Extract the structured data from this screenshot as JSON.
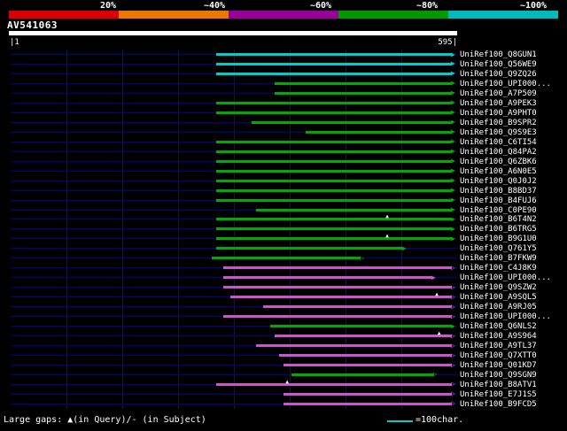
{
  "chart_data": {
    "type": "bar",
    "orientation": "horizontal-span",
    "title": "AV541063",
    "query_length": 595,
    "x_axis": {
      "start_label": "|1",
      "end_label": "595|"
    },
    "grid": true,
    "identity_scale": {
      "labels": [
        "20%",
        "~40%",
        "~60%",
        "~80%",
        "~100%"
      ],
      "colors": [
        "#dd0000",
        "#ee7700",
        "#990099",
        "#009900",
        "#00bbbb"
      ]
    },
    "bar_colors": {
      "cyan": "#00cccc",
      "green": "#00aa00",
      "magenta": "#cc55cc"
    },
    "rows": [
      {
        "label": "UniRef100_Q8GUN1",
        "color": "cyan",
        "start": 275,
        "end": 588,
        "arrow": "filled",
        "gaps": []
      },
      {
        "label": "UniRef100_Q56WE9",
        "color": "cyan",
        "start": 275,
        "end": 588,
        "arrow": "filled",
        "gaps": []
      },
      {
        "label": "UniRef100_Q9ZQ26",
        "color": "cyan",
        "start": 275,
        "end": 588,
        "arrow": "filled",
        "gaps": []
      },
      {
        "label": "UniRef100_UPI000...",
        "color": "green",
        "start": 352,
        "end": 588,
        "arrow": "filled",
        "gaps": []
      },
      {
        "label": "UniRef100_A7P509",
        "color": "green",
        "start": 352,
        "end": 588,
        "arrow": "filled",
        "gaps": []
      },
      {
        "label": "UniRef100_A9PEK3",
        "color": "green",
        "start": 275,
        "end": 588,
        "arrow": "filled",
        "gaps": []
      },
      {
        "label": "UniRef100_A9PHT0",
        "color": "green",
        "start": 275,
        "end": 588,
        "arrow": "filled",
        "gaps": []
      },
      {
        "label": "UniRef100_B9SPR2",
        "color": "green",
        "start": 322,
        "end": 588,
        "arrow": "filled",
        "gaps": []
      },
      {
        "label": "UniRef100_Q9S9E3",
        "color": "green",
        "start": 393,
        "end": 588,
        "arrow": "filled",
        "gaps": []
      },
      {
        "label": "UniRef100_C6TI54",
        "color": "green",
        "start": 275,
        "end": 588,
        "arrow": "filled",
        "gaps": []
      },
      {
        "label": "UniRef100_Q84PA2",
        "color": "green",
        "start": 275,
        "end": 588,
        "arrow": "filled",
        "gaps": []
      },
      {
        "label": "UniRef100_Q6ZBK6",
        "color": "green",
        "start": 275,
        "end": 588,
        "arrow": "filled",
        "gaps": []
      },
      {
        "label": "UniRef100_A6N0E5",
        "color": "green",
        "start": 275,
        "end": 588,
        "arrow": "filled",
        "gaps": []
      },
      {
        "label": "UniRef100_Q0J0J2",
        "color": "green",
        "start": 275,
        "end": 588,
        "arrow": "filled",
        "gaps": []
      },
      {
        "label": "UniRef100_B8BD37",
        "color": "green",
        "start": 275,
        "end": 588,
        "arrow": "filled",
        "gaps": []
      },
      {
        "label": "UniRef100_B4FUJ6",
        "color": "green",
        "start": 275,
        "end": 588,
        "arrow": "filled",
        "gaps": []
      },
      {
        "label": "UniRef100_C0PE90",
        "color": "green",
        "start": 328,
        "end": 588,
        "arrow": "filled",
        "gaps": []
      },
      {
        "label": "UniRef100_B6T4N2",
        "color": "green",
        "start": 275,
        "end": 588,
        "arrow": "filled",
        "gaps": [
          502
        ]
      },
      {
        "label": "UniRef100_B6TRG5",
        "color": "green",
        "start": 275,
        "end": 588,
        "arrow": "filled",
        "gaps": []
      },
      {
        "label": "UniRef100_B9G1U0",
        "color": "green",
        "start": 275,
        "end": 588,
        "arrow": "filled",
        "gaps": [
          502
        ]
      },
      {
        "label": "UniRef100_Q761Y5",
        "color": "green",
        "start": 275,
        "end": 523,
        "arrow": "filled",
        "gaps": []
      },
      {
        "label": "UniRef100_B7FKW9",
        "color": "green",
        "start": 269,
        "end": 467,
        "arrow": "open",
        "gaps": []
      },
      {
        "label": "UniRef100_C4J8K9",
        "color": "magenta",
        "start": 284,
        "end": 588,
        "arrow": "open",
        "gaps": []
      },
      {
        "label": "UniRef100_UPI000...",
        "color": "magenta",
        "start": 284,
        "end": 562,
        "arrow": "filled",
        "gaps": []
      },
      {
        "label": "UniRef100_Q9SZW2",
        "color": "magenta",
        "start": 284,
        "end": 588,
        "arrow": "open",
        "gaps": []
      },
      {
        "label": "UniRef100_A9SQL5",
        "color": "magenta",
        "start": 293,
        "end": 588,
        "arrow": "open",
        "gaps": [
          568
        ]
      },
      {
        "label": "UniRef100_A9RJ05",
        "color": "magenta",
        "start": 337,
        "end": 588,
        "arrow": "open",
        "gaps": []
      },
      {
        "label": "UniRef100_UPI000...",
        "color": "magenta",
        "start": 284,
        "end": 588,
        "arrow": "open",
        "gaps": []
      },
      {
        "label": "UniRef100_Q6NLS2",
        "color": "green",
        "start": 346,
        "end": 588,
        "arrow": "filled",
        "gaps": []
      },
      {
        "label": "UniRef100_A9S964",
        "color": "magenta",
        "start": 352,
        "end": 588,
        "arrow": "open",
        "gaps": [
          571
        ]
      },
      {
        "label": "UniRef100_A9TL37",
        "color": "magenta",
        "start": 328,
        "end": 588,
        "arrow": "open",
        "gaps": []
      },
      {
        "label": "UniRef100_Q7XTT0",
        "color": "magenta",
        "start": 358,
        "end": 588,
        "arrow": "open",
        "gaps": []
      },
      {
        "label": "UniRef100_Q01KD7",
        "color": "magenta",
        "start": 364,
        "end": 588,
        "arrow": "open",
        "gaps": []
      },
      {
        "label": "UniRef100_Q9SGN9",
        "color": "green",
        "start": 375,
        "end": 564,
        "arrow": "open",
        "gaps": []
      },
      {
        "label": "UniRef100_B8ATV1",
        "color": "magenta",
        "start": 275,
        "end": 588,
        "arrow": "open",
        "gaps": [
          369
        ]
      },
      {
        "label": "UniRef100_E7J1S5",
        "color": "magenta",
        "start": 364,
        "end": 588,
        "arrow": "open",
        "gaps": []
      },
      {
        "label": "UniRef100_B9FCD5",
        "color": "magenta",
        "start": 364,
        "end": 588,
        "arrow": "open",
        "gaps": []
      }
    ]
  },
  "footer": {
    "gaps_legend": "Large gaps: ▲(in Query)/- (in Subject)",
    "scale_line_legend": "=100char.",
    "scale_line_color": "#00cccc"
  }
}
